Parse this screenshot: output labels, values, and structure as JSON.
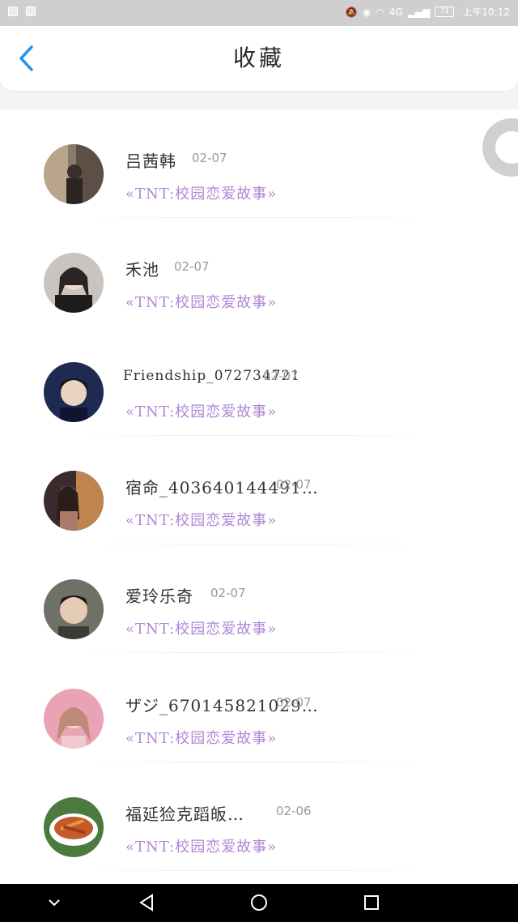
{
  "status_bar": {
    "time": "上午10:12",
    "battery": "71",
    "network": "4G"
  },
  "header": {
    "title": "收藏",
    "back_icon": "chevron-left-icon"
  },
  "colors": {
    "accent": "#2a95e8",
    "story_purple": "#b087d6",
    "date_gray": "#9a9a9a"
  },
  "items": [
    {
      "name": "吕茜韩",
      "date": "02-07",
      "story": "«TNT:校园恋爱故事»",
      "avatar": "photo-avatar"
    },
    {
      "name": "禾池",
      "date": "02-07",
      "story": "«TNT:校园恋爱故事»",
      "avatar": "photo-avatar"
    },
    {
      "name": "Friendship_072734721",
      "date": "02-07",
      "story": "«TNT:校园恋爱故事»",
      "avatar": "photo-avatar"
    },
    {
      "name": "宿命_403640144491…",
      "date": "02-07",
      "story": "«TNT:校园恋爱故事»",
      "avatar": "photo-avatar"
    },
    {
      "name": "爱玲乐奇",
      "date": "02-07",
      "story": "«TNT:校园恋爱故事»",
      "avatar": "photo-avatar"
    },
    {
      "name": "ザジ_670145821029…",
      "date": "02-07",
      "story": "«TNT:校园恋爱故事»",
      "avatar": "photo-avatar"
    },
    {
      "name": "福延猃克蹈皈…",
      "date": "02-06",
      "story": "«TNT:校园恋爱故事»",
      "avatar": "photo-avatar"
    }
  ],
  "nav": {
    "down": "chevron-down-icon",
    "back": "triangle-back-icon",
    "home": "circle-home-icon",
    "recents": "square-recents-icon"
  }
}
